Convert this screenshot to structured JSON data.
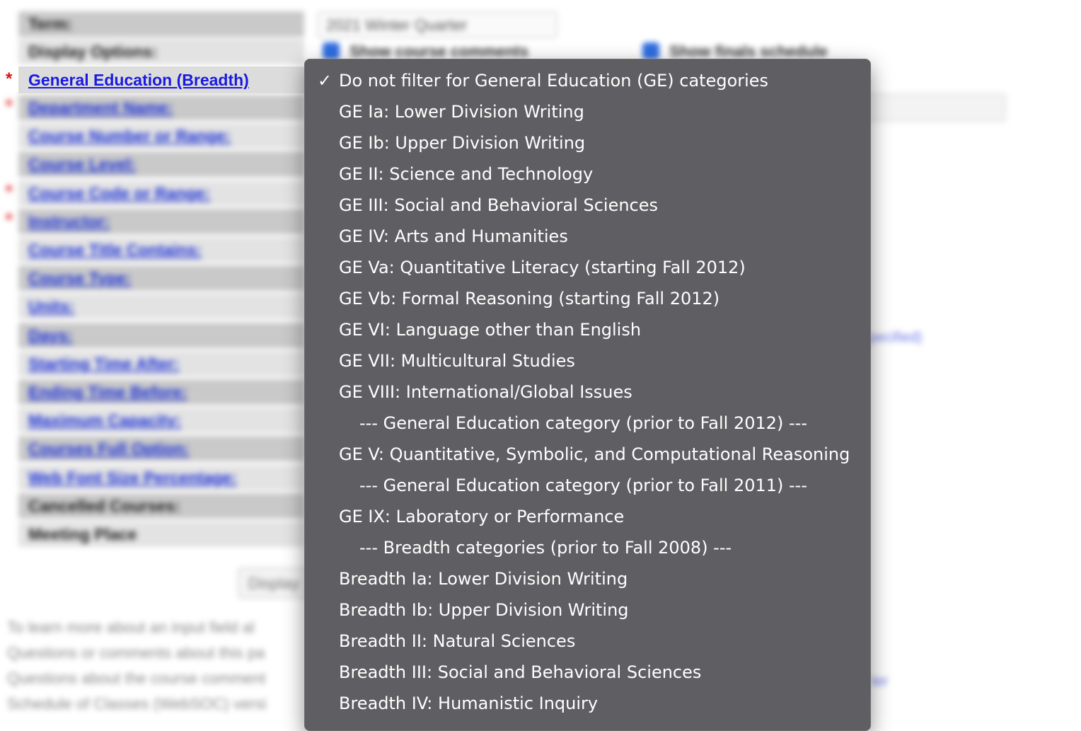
{
  "form": {
    "term_label": "Term:",
    "term_value": "2021 Winter Quarter",
    "display_options_label": "Display Options:",
    "show_course_comments": "Show course comments",
    "show_finals_schedule": "Show finals schedule",
    "ge_label": "General Education (Breadth)",
    "rows": [
      {
        "label": "Department Name:",
        "link": true,
        "required": true
      },
      {
        "label": "Course Number or Range:",
        "link": true,
        "required": false
      },
      {
        "label": "Course Level:",
        "link": true,
        "required": false
      },
      {
        "label": "Course Code or Range:",
        "link": true,
        "required": true
      },
      {
        "label": "Instructor:",
        "link": true,
        "required": true
      },
      {
        "label": "Course Title Contains:",
        "link": true,
        "required": false
      },
      {
        "label": "Course Type:",
        "link": true,
        "required": false
      },
      {
        "label": "Units:",
        "link": true,
        "required": false
      },
      {
        "label": "Days:",
        "link": true,
        "required": false
      },
      {
        "label": "Starting Time After:",
        "link": true,
        "required": false
      },
      {
        "label": "Ending Time Before:",
        "link": true,
        "required": false
      },
      {
        "label": "Maximum Capacity:",
        "link": true,
        "required": false
      },
      {
        "label": "Courses Full Option:",
        "link": true,
        "required": false
      },
      {
        "label": "Web Font Size Percentage:",
        "link": true,
        "required": false
      },
      {
        "label": "Cancelled Courses:",
        "link": false,
        "required": false
      },
      {
        "label": "Meeting Place",
        "link": false,
        "required": false
      }
    ],
    "display_button": "Display",
    "footer_lines": [
      "To learn more about an input field al",
      "Questions or comments about this pa",
      "Questions about the course comment",
      "Schedule of Classes (WebSOC) versi"
    ],
    "side_link_1": "pecified)",
    "side_link_2": "ter"
  },
  "dropdown": {
    "checkmark": "✓",
    "options": [
      {
        "label": "Do not filter for General Education (GE) categories",
        "selected": true,
        "indent": false
      },
      {
        "label": "GE Ia: Lower Division Writing",
        "selected": false,
        "indent": false
      },
      {
        "label": "GE Ib: Upper Division Writing",
        "selected": false,
        "indent": false
      },
      {
        "label": "GE II: Science and Technology",
        "selected": false,
        "indent": false
      },
      {
        "label": "GE III: Social and Behavioral Sciences",
        "selected": false,
        "indent": false
      },
      {
        "label": "GE IV: Arts and Humanities",
        "selected": false,
        "indent": false
      },
      {
        "label": "GE Va: Quantitative Literacy (starting Fall 2012)",
        "selected": false,
        "indent": false
      },
      {
        "label": "GE Vb: Formal Reasoning (starting Fall 2012)",
        "selected": false,
        "indent": false
      },
      {
        "label": "GE VI: Language other than English",
        "selected": false,
        "indent": false
      },
      {
        "label": "GE VII: Multicultural Studies",
        "selected": false,
        "indent": false
      },
      {
        "label": "GE VIII: International/Global Issues",
        "selected": false,
        "indent": false
      },
      {
        "label": "--- General Education category (prior to Fall 2012) ---",
        "selected": false,
        "indent": true
      },
      {
        "label": "GE V: Quantitative, Symbolic, and Computational Reasoning",
        "selected": false,
        "indent": false
      },
      {
        "label": "--- General Education category (prior to Fall 2011) ---",
        "selected": false,
        "indent": true
      },
      {
        "label": "GE IX: Laboratory or Performance",
        "selected": false,
        "indent": false
      },
      {
        "label": "--- Breadth categories (prior to Fall 2008) ---",
        "selected": false,
        "indent": true
      },
      {
        "label": "Breadth Ia: Lower Division Writing",
        "selected": false,
        "indent": false
      },
      {
        "label": "Breadth Ib: Upper Division Writing",
        "selected": false,
        "indent": false
      },
      {
        "label": "Breadth II: Natural Sciences",
        "selected": false,
        "indent": false
      },
      {
        "label": "Breadth III: Social and Behavioral Sciences",
        "selected": false,
        "indent": false
      },
      {
        "label": "Breadth IV: Humanistic Inquiry",
        "selected": false,
        "indent": false
      }
    ]
  }
}
